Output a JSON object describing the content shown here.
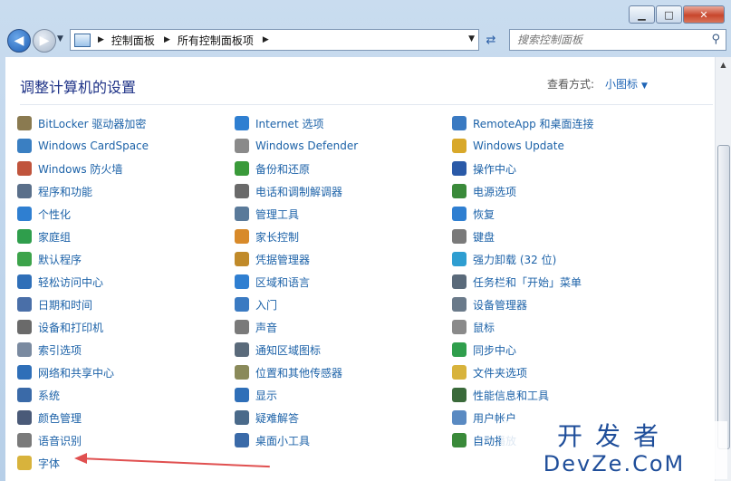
{
  "window": {
    "caption": {
      "minimize": "▁",
      "maximize": "□",
      "close": "✕"
    }
  },
  "nav": {
    "breadcrumb": [
      "控制面板",
      "所有控制面板项"
    ],
    "search_placeholder": "搜索控制面板"
  },
  "header": {
    "title": "调整计算机的设置",
    "view_by_label": "查看方式:",
    "view_by_value": "小图标"
  },
  "items": {
    "col1": [
      {
        "label": "BitLocker 驱动器加密",
        "icon": "bitlocker-icon",
        "color": "#8a7a50"
      },
      {
        "label": "Windows CardSpace",
        "icon": "cardspace-icon",
        "color": "#3a7fc2"
      },
      {
        "label": "Windows 防火墙",
        "icon": "firewall-icon",
        "color": "#c0543c"
      },
      {
        "label": "程序和功能",
        "icon": "programs-icon",
        "color": "#5a6f8a"
      },
      {
        "label": "个性化",
        "icon": "personalize-icon",
        "color": "#2f7fd1"
      },
      {
        "label": "家庭组",
        "icon": "homegroup-icon",
        "color": "#2f9e4c"
      },
      {
        "label": "默认程序",
        "icon": "default-programs-icon",
        "color": "#3ca34a"
      },
      {
        "label": "轻松访问中心",
        "icon": "ease-of-access-icon",
        "color": "#2f6fb8"
      },
      {
        "label": "日期和时间",
        "icon": "clock-icon",
        "color": "#4a6fa8"
      },
      {
        "label": "设备和打印机",
        "icon": "printer-icon",
        "color": "#6a6a6a"
      },
      {
        "label": "索引选项",
        "icon": "indexing-icon",
        "color": "#7a8aa0"
      },
      {
        "label": "网络和共享中心",
        "icon": "network-icon",
        "color": "#2f6fb8"
      },
      {
        "label": "系统",
        "icon": "system-icon",
        "color": "#3a6aa8"
      },
      {
        "label": "颜色管理",
        "icon": "color-management-icon",
        "color": "#4a5a78"
      },
      {
        "label": "语音识别",
        "icon": "microphone-icon",
        "color": "#7a7a7a"
      },
      {
        "label": "字体",
        "icon": "fonts-folder-icon",
        "color": "#d8b33c"
      }
    ],
    "col2": [
      {
        "label": "Internet 选项",
        "icon": "internet-options-icon",
        "color": "#2f7fd1"
      },
      {
        "label": "Windows Defender",
        "icon": "defender-icon",
        "color": "#8a8a8a"
      },
      {
        "label": "备份和还原",
        "icon": "backup-icon",
        "color": "#3a9a3a"
      },
      {
        "label": "电话和调制解调器",
        "icon": "phone-modem-icon",
        "color": "#6a6a6a"
      },
      {
        "label": "管理工具",
        "icon": "admin-tools-icon",
        "color": "#5a7a9a"
      },
      {
        "label": "家长控制",
        "icon": "parental-controls-icon",
        "color": "#d88a2a"
      },
      {
        "label": "凭据管理器",
        "icon": "credential-icon",
        "color": "#c08a2a"
      },
      {
        "label": "区域和语言",
        "icon": "region-icon",
        "color": "#2f7fd1"
      },
      {
        "label": "入门",
        "icon": "getting-started-icon",
        "color": "#3a7ac2"
      },
      {
        "label": "声音",
        "icon": "speaker-icon",
        "color": "#7a7a7a"
      },
      {
        "label": "通知区域图标",
        "icon": "notification-icon",
        "color": "#5a6a7a"
      },
      {
        "label": "位置和其他传感器",
        "icon": "sensor-icon",
        "color": "#8a8a5a"
      },
      {
        "label": "显示",
        "icon": "display-icon",
        "color": "#2f6fb8"
      },
      {
        "label": "疑难解答",
        "icon": "troubleshoot-icon",
        "color": "#4a6a8a"
      },
      {
        "label": "桌面小工具",
        "icon": "gadgets-icon",
        "color": "#3a6aa8"
      }
    ],
    "col3": [
      {
        "label": "RemoteApp 和桌面连接",
        "icon": "remoteapp-icon",
        "color": "#3a7ac2"
      },
      {
        "label": "Windows Update",
        "icon": "windows-update-icon",
        "color": "#d8a82a"
      },
      {
        "label": "操作中心",
        "icon": "action-center-icon",
        "color": "#2a5aa8"
      },
      {
        "label": "电源选项",
        "icon": "power-icon",
        "color": "#3a8a3a"
      },
      {
        "label": "恢复",
        "icon": "recovery-icon",
        "color": "#2f7fd1"
      },
      {
        "label": "键盘",
        "icon": "keyboard-icon",
        "color": "#7a7a7a"
      },
      {
        "label": "强力卸载 (32 位)",
        "icon": "uninstall-icon",
        "color": "#2f9ed1"
      },
      {
        "label": "任务栏和「开始」菜单",
        "icon": "taskbar-icon",
        "color": "#5a6a7a"
      },
      {
        "label": "设备管理器",
        "icon": "device-manager-icon",
        "color": "#6a7a8a"
      },
      {
        "label": "鼠标",
        "icon": "mouse-icon",
        "color": "#8a8a8a"
      },
      {
        "label": "同步中心",
        "icon": "sync-icon",
        "color": "#2f9e4c"
      },
      {
        "label": "文件夹选项",
        "icon": "folder-options-icon",
        "color": "#d8b33c"
      },
      {
        "label": "性能信息和工具",
        "icon": "performance-icon",
        "color": "#3a6a3a"
      },
      {
        "label": "用户帐户",
        "icon": "user-accounts-icon",
        "color": "#5a8ac2"
      },
      {
        "label": "自动播放",
        "icon": "autoplay-icon",
        "color": "#3a8a3a"
      }
    ]
  },
  "watermark": {
    "cn": "开发者",
    "en": "DevZe.CoM"
  }
}
